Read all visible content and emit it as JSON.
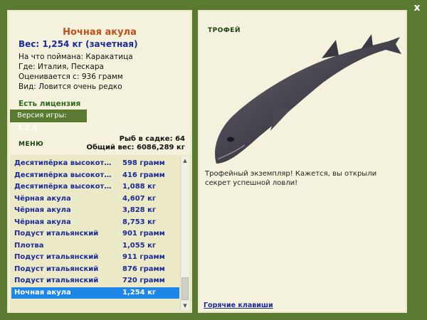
{
  "window": {
    "close_label": "x"
  },
  "fish": {
    "name": "Ночная акула",
    "weight_line": "Вес: 1,254 кг (зачетная)",
    "bait_line": "На что поймана: Каракатица",
    "where_line": "Где: Италия, Пескара",
    "value_line": "Оценивается с: 936 грамм",
    "kind_line": "Вид: Ловится очень редко"
  },
  "license": "Есть лицензия",
  "version": {
    "prefix": "Версия игры: ",
    "number": "3.7.6"
  },
  "menu": "МЕНЮ",
  "stats": {
    "count_line": "Рыб в садке: 64",
    "total_line": "Общий вес: 6086,289 кг"
  },
  "catches": [
    {
      "name": "Десятипёрка высокоте...",
      "weight": "598 грамм"
    },
    {
      "name": "Десятипёрка высокоте...",
      "weight": "416 грамм"
    },
    {
      "name": "Десятипёрка высокоте...",
      "weight": "1,088 кг"
    },
    {
      "name": "Чёрная акула",
      "weight": "4,607 кг"
    },
    {
      "name": "Чёрная акула",
      "weight": "3,828 кг"
    },
    {
      "name": "Чёрная акула",
      "weight": "8,753 кг"
    },
    {
      "name": "Подуст итальянский",
      "weight": "901 грамм"
    },
    {
      "name": "Плотва",
      "weight": "1,055 кг"
    },
    {
      "name": "Подуст итальянский",
      "weight": "911 грамм"
    },
    {
      "name": "Подуст итальянский",
      "weight": "876 грамм"
    },
    {
      "name": "Подуст итальянский",
      "weight": "720 грамм"
    },
    {
      "name": "Ночная акула",
      "weight": "1,254 кг"
    }
  ],
  "selected_index": 11,
  "trophy": {
    "label": "ТРОФЕЙ",
    "text": "Трофейный экземпляр! Кажется, вы открыли секрет успешной ловли!"
  },
  "hotkeys": "Горячие клавиши",
  "icons": {
    "close": "close-icon",
    "scroll_up": "arrow-up-icon",
    "scroll_down": "arrow-down-icon",
    "fish_picture": "shark-image"
  },
  "colors": {
    "frame": "#5a7a32",
    "panel": "#f4f2dd",
    "title": "#c0501a",
    "text_blue": "#1a2a9a",
    "selected": "#1e86e6"
  }
}
